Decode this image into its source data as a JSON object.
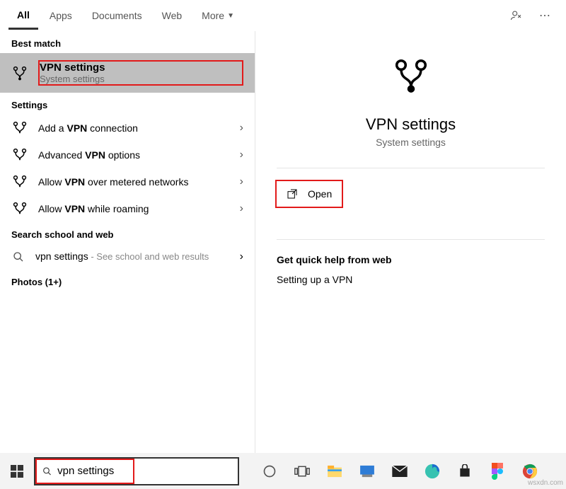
{
  "tabs": {
    "all": "All",
    "apps": "Apps",
    "documents": "Documents",
    "web": "Web",
    "more": "More"
  },
  "sections": {
    "best_match": "Best match",
    "settings": "Settings",
    "search_web": "Search school and web",
    "photos": "Photos (1+)"
  },
  "best_match": {
    "title_pre": "",
    "title_bold": "VPN settings",
    "title_post": "",
    "subtitle": "System settings"
  },
  "settings_list": [
    {
      "pre": "Add a ",
      "bold": "VPN",
      "post": " connection"
    },
    {
      "pre": "Advanced ",
      "bold": "VPN",
      "post": " options"
    },
    {
      "pre": "Allow ",
      "bold": "VPN",
      "post": " over metered networks"
    },
    {
      "pre": "Allow ",
      "bold": "VPN",
      "post": " while roaming"
    }
  ],
  "web_result": {
    "title": "vpn settings",
    "sub": " - See school and web results"
  },
  "preview": {
    "title": "VPN settings",
    "subtitle": "System settings",
    "open": "Open",
    "help_header": "Get quick help from web",
    "help_link": "Setting up a VPN"
  },
  "search_value": "vpn settings",
  "watermark": "wsxdn.com"
}
